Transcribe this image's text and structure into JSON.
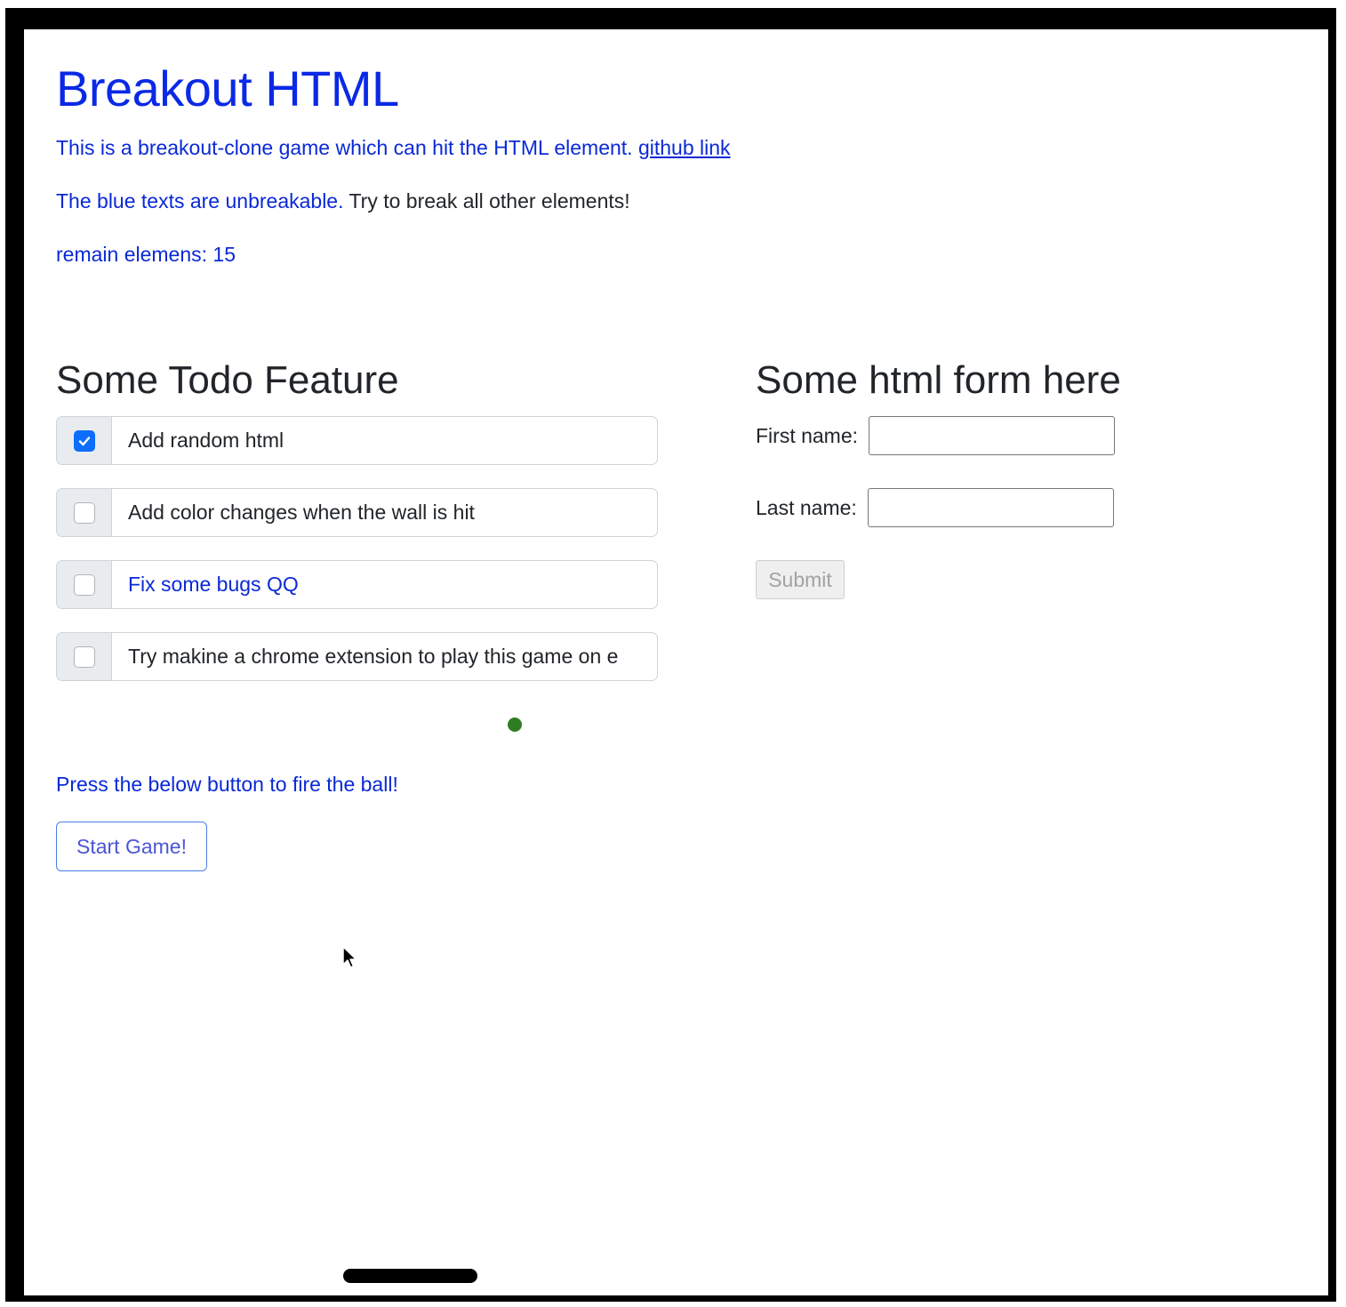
{
  "header": {
    "title": "Breakout HTML",
    "intro_text": "This is a breakout-clone game which can hit the HTML element.",
    "github_link": "github link",
    "rule_blue": "The blue texts are unbreakable.",
    "rule_rest": "Try to break all other elements!",
    "remain_label": "remain elemens:",
    "remain_count": "15"
  },
  "todo": {
    "heading": "Some Todo Feature",
    "items": [
      {
        "label": "Add random html",
        "checked": true,
        "unbreakable": false
      },
      {
        "label": "Add color changes when the wall is hit",
        "checked": false,
        "unbreakable": false
      },
      {
        "label": "Fix some bugs QQ",
        "checked": false,
        "unbreakable": true
      },
      {
        "label": "Try makine a chrome extension to play this game on e",
        "checked": false,
        "unbreakable": false
      }
    ]
  },
  "form": {
    "heading": "Some html form here",
    "first_name_label": "First name:",
    "first_name_value": "",
    "last_name_label": "Last name:",
    "last_name_value": "",
    "submit_label": "Submit"
  },
  "game": {
    "fire_prompt": "Press the below button to fire the ball!",
    "start_button": "Start Game!",
    "ball_color": "#2f7d22",
    "paddle_color": "#000000"
  },
  "colors": {
    "unbreakable_text": "#0a29d6",
    "checkbox_checked": "#0d6efd"
  }
}
